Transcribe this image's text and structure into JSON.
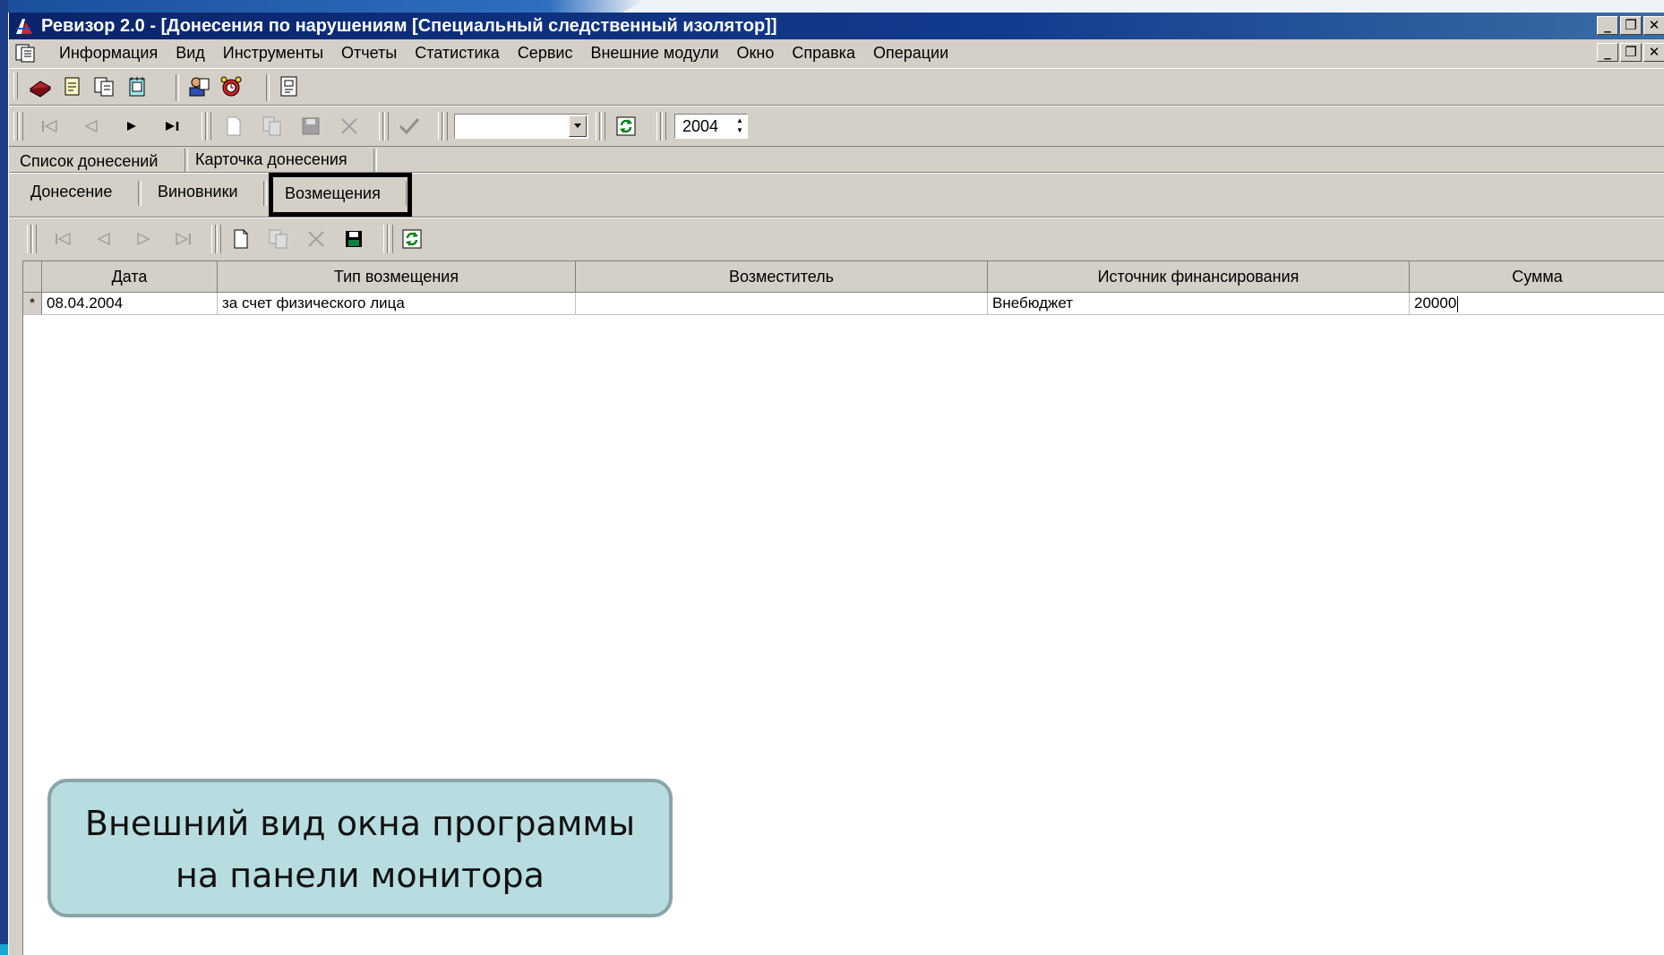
{
  "window": {
    "title": "Ревизор 2.0 - [Донесения по нарушениям [Специальный следственный изолятор]]",
    "caption_minimize": "_",
    "caption_restore": "❐",
    "caption_close": "✕"
  },
  "menu": {
    "items": [
      "Информация",
      "Вид",
      "Инструменты",
      "Отчеты",
      "Статистика",
      "Сервис",
      "Внешние модули",
      "Окно",
      "Справка",
      "Операции"
    ]
  },
  "toolbar2": {
    "combo_value": "",
    "year": "2004"
  },
  "outer_tabs": [
    "Список донесений",
    "Карточка донесения"
  ],
  "inner_tabs": [
    "Донесение",
    "Виновники",
    "Возмещения"
  ],
  "grid": {
    "columns": [
      "Дата",
      "Тип возмещения",
      "Возместитель",
      "Источник финансирования",
      "Сумма"
    ],
    "rows": [
      {
        "indicator": "*",
        "date": "08.04.2004",
        "type": "за счет физического лица",
        "payer": "",
        "source": "Внебюджет",
        "sum": "20000"
      }
    ]
  },
  "callout": {
    "line1": "Внешний вид окна программы",
    "line2": "на панели монитора"
  },
  "colors": {
    "titlebar": "#0a246a",
    "window_face": "#d4d0c8",
    "callout_fill": "#b8dde0",
    "slide_accent": "#1a3f86"
  }
}
